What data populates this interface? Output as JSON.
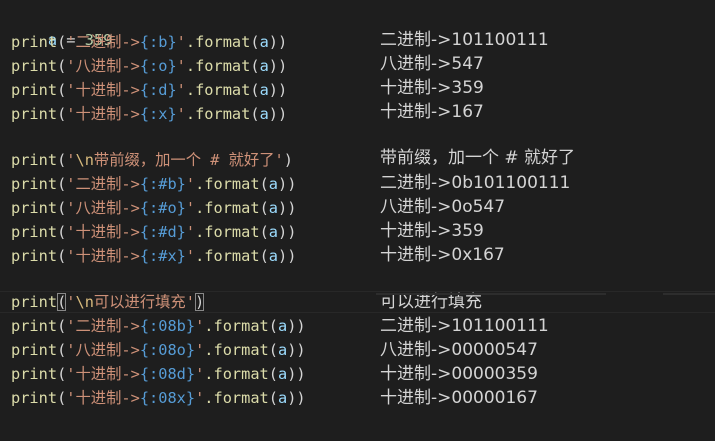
{
  "code": {
    "var_line": {
      "name": "a",
      "op": " = ",
      "value": "359"
    },
    "fn": "print",
    "method": ".format",
    "arg": "a",
    "lines": [
      {
        "pre": "('",
        "cn": "二进制->",
        "spec": "{:b}",
        "post": "'"
      },
      {
        "pre": "('",
        "cn": "八进制->",
        "spec": "{:o}",
        "post": "'"
      },
      {
        "pre": "('",
        "cn": "十进制->",
        "spec": "{:d}",
        "post": "'"
      },
      {
        "pre": "('",
        "cn": "十进制->",
        "spec": "{:x}",
        "post": "'"
      },
      {
        "pre": "('",
        "cn": "\\n带前缀，加一个 # 就好了",
        "spec": "",
        "post": "'",
        "plain": true
      },
      {
        "pre": "('",
        "cn": "二进制->",
        "spec": "{:#b}",
        "post": "'"
      },
      {
        "pre": "('",
        "cn": "八进制->",
        "spec": "{:#o}",
        "post": "'"
      },
      {
        "pre": "('",
        "cn": "十进制->",
        "spec": "{:#d}",
        "post": "'"
      },
      {
        "pre": "('",
        "cn": "十进制->",
        "spec": "{:#x}",
        "post": "'"
      },
      {
        "pre": "('",
        "cn": "\\n可以进行填充",
        "spec": "",
        "post": "'",
        "plain": true
      },
      {
        "pre": "('",
        "cn": "二进制->",
        "spec": "{:08b}",
        "post": "'"
      },
      {
        "pre": "('",
        "cn": "八进制->",
        "spec": "{:08o}",
        "post": "'"
      },
      {
        "pre": "('",
        "cn": "十进制->",
        "spec": "{:08d}",
        "post": "'"
      },
      {
        "pre": "('",
        "cn": "十进制->",
        "spec": "{:08x}",
        "post": "'"
      }
    ]
  },
  "output": [
    "二进制->101100111",
    "八进制->547",
    "十进制->359",
    "十进制->167",
    "带前缀，加一个 # 就好了",
    "二进制->0b101100111",
    "八进制->0o547",
    "十进制->359",
    "十进制->0x167",
    "可以进行填充",
    "二进制->101100111",
    "八进制->00000547",
    "十进制->00000359",
    "十进制->00000167"
  ]
}
